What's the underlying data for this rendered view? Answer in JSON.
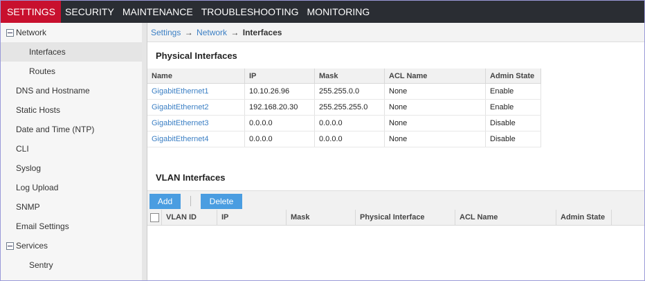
{
  "nav": {
    "tabs": [
      {
        "label": "SETTINGS"
      },
      {
        "label": "SECURITY"
      },
      {
        "label": "MAINTENANCE"
      },
      {
        "label": "TROUBLESHOOTING"
      },
      {
        "label": "MONITORING"
      }
    ],
    "active_color": "#c8102e"
  },
  "sidebar": {
    "items": [
      {
        "label": "Network"
      },
      {
        "label": "Interfaces"
      },
      {
        "label": "Routes"
      },
      {
        "label": "DNS and Hostname"
      },
      {
        "label": "Static Hosts"
      },
      {
        "label": "Date and Time (NTP)"
      },
      {
        "label": "CLI"
      },
      {
        "label": "Syslog"
      },
      {
        "label": "Log Upload"
      },
      {
        "label": "SNMP"
      },
      {
        "label": "Email Settings"
      },
      {
        "label": "Services"
      },
      {
        "label": "Sentry"
      }
    ]
  },
  "breadcrumb": {
    "settings": "Settings",
    "arrow": "→",
    "network": "Network",
    "current": "Interfaces"
  },
  "physical": {
    "title": "Physical Interfaces",
    "headers": [
      "Name",
      "IP",
      "Mask",
      "ACL Name",
      "Admin State"
    ],
    "rows": [
      [
        "GigabitEthernet1",
        "10.10.26.96",
        "255.255.0.0",
        "None",
        "Enable"
      ],
      [
        "GigabitEthernet2",
        "192.168.20.30",
        "255.255.255.0",
        "None",
        "Enable"
      ],
      [
        "GigabitEthernet3",
        "0.0.0.0",
        "0.0.0.0",
        "None",
        "Disable"
      ],
      [
        "GigabitEthernet4",
        "0.0.0.0",
        "0.0.0.0",
        "None",
        "Disable"
      ]
    ]
  },
  "vlan": {
    "title": "VLAN Interfaces",
    "add": "Add",
    "delete": "Delete",
    "headers": [
      "VLAN ID",
      "IP",
      "Mask",
      "Physical Interface",
      "ACL Name",
      "Admin State"
    ]
  },
  "colors": {
    "link": "#3b7fc4",
    "button": "#4a9de1",
    "topbar": "#2a2d33"
  }
}
